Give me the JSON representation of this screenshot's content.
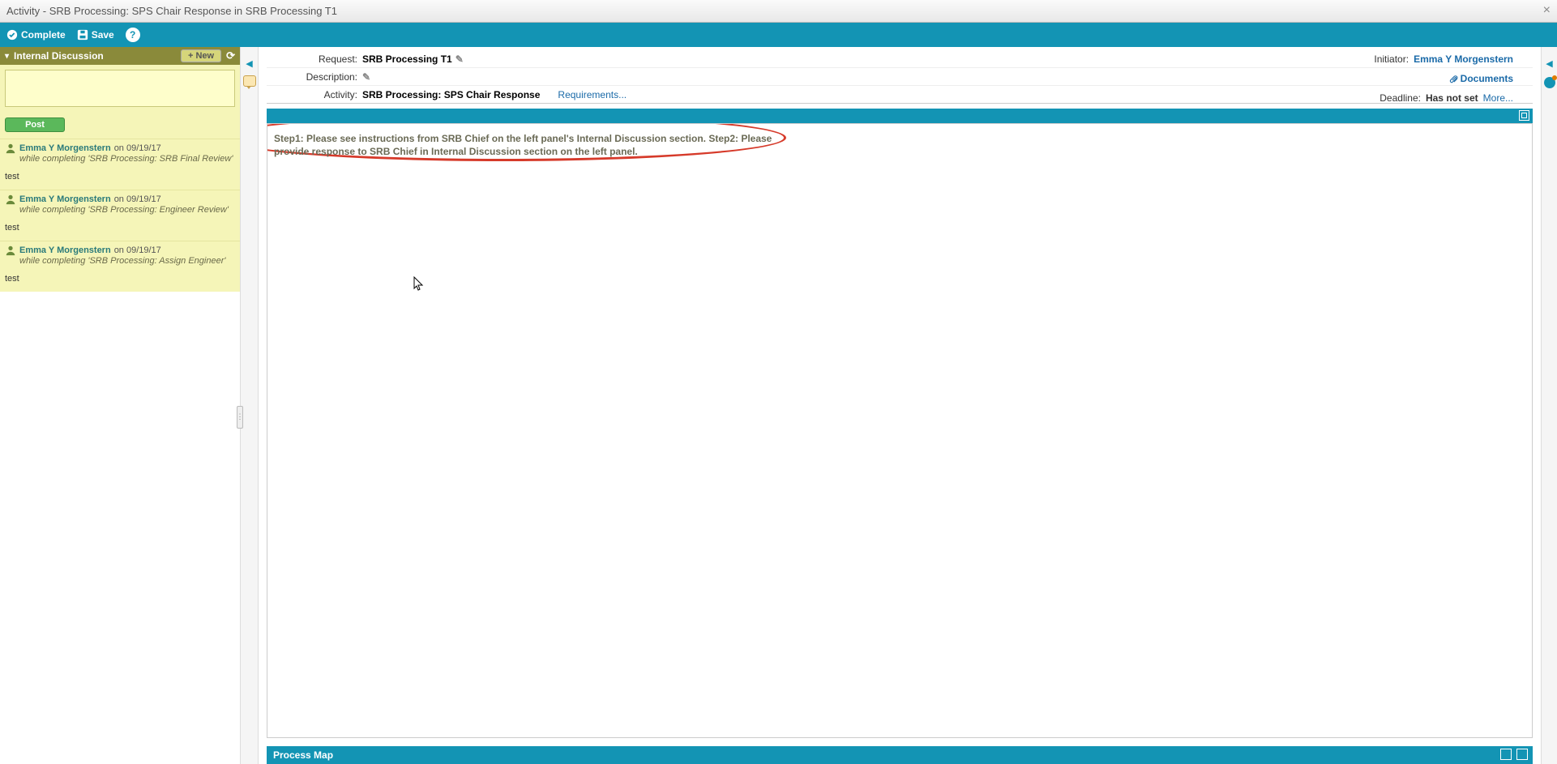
{
  "window": {
    "title": "Activity - SRB Processing: SPS Chair Response in SRB Processing T1"
  },
  "toolbar": {
    "complete": "Complete",
    "save": "Save"
  },
  "discussion": {
    "header": "Internal Discussion",
    "new_btn": "+ New",
    "post_btn": "Post",
    "posts": [
      {
        "author": "Emma Y Morgenstern",
        "date": "on 09/19/17",
        "context": "while completing 'SRB Processing: SRB Final Review'",
        "body": "test"
      },
      {
        "author": "Emma Y Morgenstern",
        "date": "on 09/19/17",
        "context": "while completing 'SRB Processing: Engineer Review'",
        "body": "test"
      },
      {
        "author": "Emma Y Morgenstern",
        "date": "on 09/19/17",
        "context": "while completing 'SRB Processing: Assign Engineer'",
        "body": "test"
      }
    ]
  },
  "info": {
    "request_label": "Request:",
    "request_value": "SRB Processing T1",
    "description_label": "Description:",
    "activity_label": "Activity:",
    "activity_value": "SRB Processing: SPS Chair Response",
    "requirements_link": "Requirements...",
    "initiator_label": "Initiator:",
    "initiator_value": "Emma Y Morgenstern",
    "documents_link": "Documents",
    "deadline_label": "Deadline:",
    "deadline_value": "Has not set",
    "more_link": "More..."
  },
  "content": {
    "step_text": "Step1: Please see instructions from SRB Chief on the left panel's Internal Discussion section. Step2: Please provide response to SRB Chief in Internal Discussion section on the left panel."
  },
  "process_map": {
    "title": "Process Map"
  }
}
